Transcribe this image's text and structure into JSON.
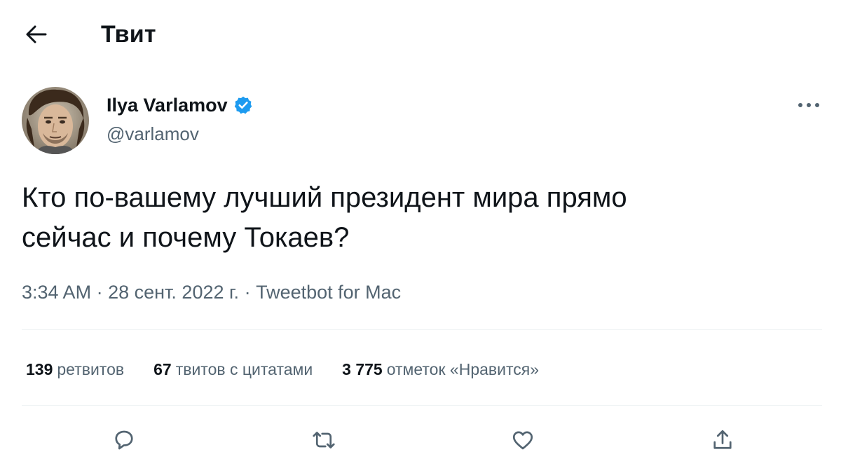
{
  "header": {
    "title": "Твит"
  },
  "author": {
    "display_name": "Ilya Varlamov",
    "handle": "@varlamov"
  },
  "tweet": {
    "text": "Кто по-вашему лучший президент мира прямо\nсейчас и почему Токаев?",
    "time": "3:34 AM",
    "date": "28 сент. 2022 г.",
    "source": "Tweetbot for Mac",
    "separator": "·"
  },
  "stats": {
    "retweets": {
      "count": "139",
      "label": "ретвитов"
    },
    "quotes": {
      "count": "67",
      "label": "твитов с цитатами"
    },
    "likes": {
      "count": "3 775",
      "label": "отметок «Нравится»"
    }
  },
  "icons": {
    "back": "arrow-left-icon",
    "verified": "verified-badge-icon",
    "more": "more-dots-icon",
    "reply": "reply-icon",
    "retweet": "retweet-icon",
    "like": "heart-icon",
    "share": "share-icon"
  },
  "colors": {
    "text": "#0f1419",
    "secondary": "#536471",
    "verified": "#1d9bf0",
    "divider": "#eff3f4"
  }
}
